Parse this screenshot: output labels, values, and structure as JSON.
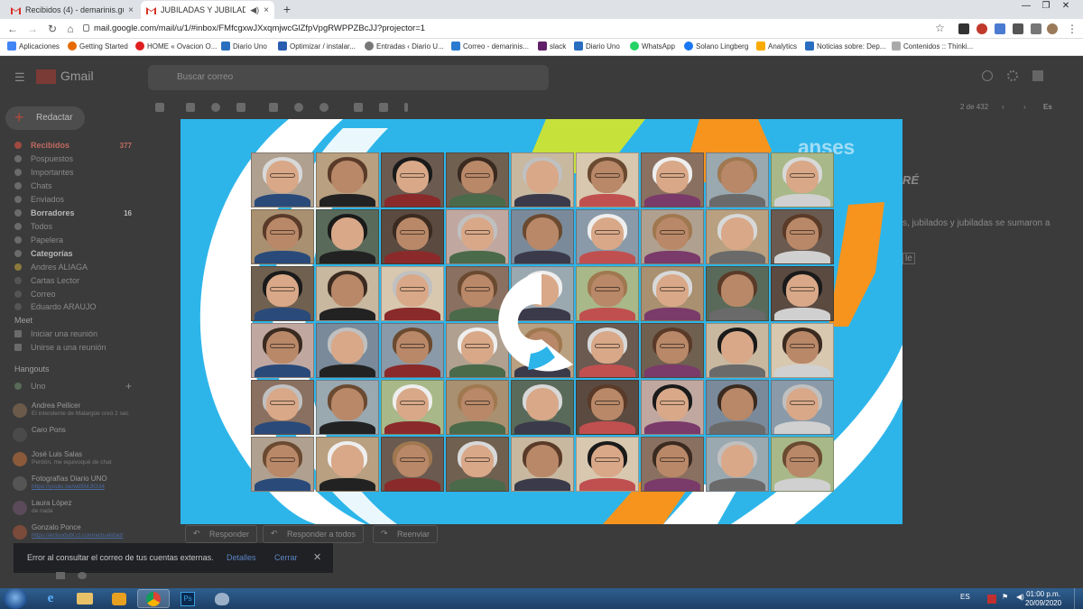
{
  "browser": {
    "tabs": [
      {
        "title": "Recibidos (4) - demarinis.gustavo",
        "close": "×",
        "active": false
      },
      {
        "title": "JUBILADAS Y JUBILADOS DE",
        "close": "×",
        "active": true
      }
    ],
    "new_tab": "+",
    "window_controls": [
      "—",
      "❐",
      "✕"
    ],
    "url": "mail.google.com/mail/u/1/#inbox/FMfcgxwJXxqmjwcGlZfpVpgRWPPZBcJJ?projector=1",
    "bookmarks": [
      "Aplicaciones",
      "Getting Started",
      "HOME « Ovacion O...",
      "Diario Uno",
      "Optimizar / instalar...",
      "Entradas ‹ Diario U...",
      "Correo - demarinis...",
      "slack",
      "Diario Uno",
      "WhatsApp",
      "Solano Lingberg",
      "Analytics",
      "Noticias sobre: Dep...",
      "Contenidos :: Thinki..."
    ]
  },
  "gmail": {
    "logo": "Gmail",
    "search_placeholder": "Buscar correo",
    "compose": "Redactar",
    "nav": [
      {
        "label": "Recibidos",
        "count": "377"
      },
      {
        "label": "Pospuestos",
        "count": ""
      },
      {
        "label": "Importantes",
        "count": ""
      },
      {
        "label": "Chats",
        "count": ""
      },
      {
        "label": "Enviados",
        "count": ""
      },
      {
        "label": "Borradores",
        "count": "16"
      },
      {
        "label": "Todos",
        "count": ""
      },
      {
        "label": "Papelera",
        "count": ""
      },
      {
        "label": "Categorías",
        "count": ""
      },
      {
        "label": "Andres ALIAGA",
        "count": ""
      },
      {
        "label": "Cartas Lector",
        "count": ""
      },
      {
        "label": "Correo",
        "count": ""
      },
      {
        "label": "Eduardo ARAUJO",
        "count": ""
      }
    ],
    "meet": {
      "title": "Meet",
      "items": [
        "Iniciar una reunión",
        "Unirse a una reunión"
      ]
    },
    "hangouts": {
      "title": "Hangouts",
      "user": "Uno",
      "contacts": [
        {
          "name": "Andrea Pellicer",
          "status": "El intendente de Malargüe creó 2 sec",
          "link": false
        },
        {
          "name": "Caro Pons",
          "status": "",
          "link": false
        },
        {
          "name": "José Luis Salas",
          "status": "Perdón, me equivoqué de chat",
          "link": false
        },
        {
          "name": "Fotografías Diario UNO",
          "status": "https://youtu.be/wd5MJIO34",
          "link": true
        },
        {
          "name": "Laura López",
          "status": "de nada",
          "link": false
        },
        {
          "name": "Gonzalo Ponce",
          "status": "https://ecloudubl.ct.com/actualidad/",
          "link": true
        }
      ]
    },
    "pager": "2 de 432",
    "lang": "Es",
    "mail_title": "RÉ",
    "mail_text_1": "s, jubilados y jubiladas se sumaron a",
    "mail_text_2": "le",
    "reply_buttons": [
      "Responder",
      "Responder a todos",
      "Reenviar"
    ],
    "toast": {
      "message": "Error al consultar el correo de tus cuentas externas.",
      "details": "Detalles",
      "close_label": "Cerrar",
      "close_x": "✕"
    }
  },
  "projector": {
    "logo": "anses",
    "rows": 6,
    "cols": 9
  },
  "taskbar": {
    "lang": "ES",
    "time": "01:00 p.m.",
    "date": "20/09/2020"
  }
}
